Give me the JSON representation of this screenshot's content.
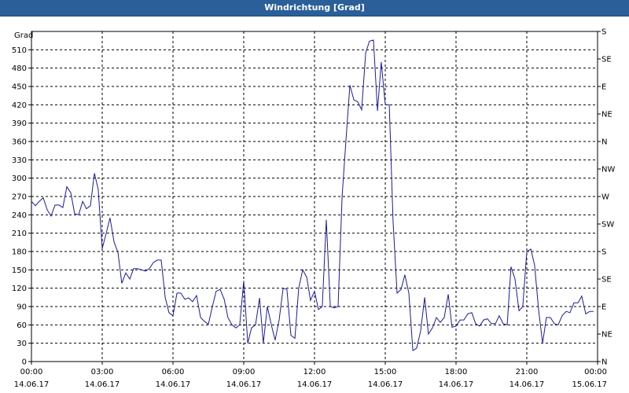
{
  "window": {
    "title": "Windrichtung [Grad]"
  },
  "chart_data": {
    "type": "line",
    "title": "Windrichtung [Grad]",
    "ylabel": "Grad",
    "ylim": [
      0,
      540
    ],
    "yticks": [
      0,
      30,
      60,
      90,
      120,
      150,
      180,
      210,
      240,
      270,
      300,
      330,
      360,
      390,
      420,
      450,
      480,
      510
    ],
    "right_axis_labels": [
      "N",
      "NE",
      "E",
      "SE",
      "S",
      "SW",
      "W",
      "NW",
      "N",
      "NE",
      "E",
      "SE",
      "S"
    ],
    "right_axis_values": [
      0,
      45,
      90,
      135,
      180,
      225,
      270,
      315,
      360,
      405,
      450,
      495,
      540
    ],
    "xlim": [
      0,
      24
    ],
    "xticks": [
      {
        "hours": 0,
        "time": "00:00",
        "date": "14.06.17"
      },
      {
        "hours": 3,
        "time": "03:00",
        "date": "14.06.17"
      },
      {
        "hours": 6,
        "time": "06:00",
        "date": "14.06.17"
      },
      {
        "hours": 9,
        "time": "09:00",
        "date": "14.06.17"
      },
      {
        "hours": 12,
        "time": "12:00",
        "date": "14.06.17"
      },
      {
        "hours": 15,
        "time": "15:00",
        "date": "14.06.17"
      },
      {
        "hours": 18,
        "time": "18:00",
        "date": "14.06.17"
      },
      {
        "hours": 21,
        "time": "21:00",
        "date": "14.06.17"
      },
      {
        "hours": 24,
        "time": "00:00",
        "date": "15.06.17"
      }
    ],
    "grid": true,
    "colors": {
      "series": "#1a1aa0",
      "grid": "#000000",
      "title_bg": "#2a5f9a"
    },
    "series": [
      {
        "x": [
          0.0,
          0.17,
          0.33,
          0.5,
          0.67,
          0.83,
          1.0,
          1.17,
          1.33,
          1.5,
          1.67,
          1.83,
          2.0,
          2.17,
          2.33,
          2.5,
          2.67,
          2.83,
          3.0,
          3.17,
          3.33,
          3.5,
          3.67,
          3.83,
          4.0,
          4.17,
          4.33,
          4.5,
          4.67,
          4.83,
          5.0,
          5.17,
          5.33,
          5.5,
          5.67,
          5.83,
          6.0,
          6.17,
          6.33,
          6.5,
          6.67,
          6.83,
          7.0,
          7.17,
          7.33,
          7.5,
          7.67,
          7.83,
          8.0,
          8.17,
          8.33,
          8.5,
          8.67,
          8.83,
          9.0,
          9.17,
          9.33,
          9.5,
          9.67,
          9.83,
          10.0,
          10.17,
          10.33,
          10.5,
          10.67,
          10.83,
          11.0,
          11.17,
          11.33,
          11.5,
          11.67,
          11.83,
          12.0,
          12.17,
          12.33,
          12.5,
          12.67,
          12.83,
          13.0,
          13.17,
          13.33,
          13.5,
          13.67,
          13.83,
          14.0,
          14.17,
          14.33,
          14.5,
          14.67,
          14.83,
          15.0,
          15.17,
          15.33,
          15.5,
          15.67,
          15.83,
          16.0,
          16.17,
          16.33,
          16.5,
          16.67,
          16.83,
          17.0,
          17.17,
          17.33,
          17.5,
          17.67,
          17.83,
          18.0,
          18.17,
          18.33,
          18.5,
          18.67,
          18.83,
          19.0,
          19.17,
          19.33,
          19.5,
          19.67,
          19.83,
          20.0,
          20.17,
          20.33,
          20.5,
          20.67,
          20.83,
          21.0,
          21.17,
          21.33,
          21.5,
          21.67,
          21.83,
          22.0,
          22.17,
          22.33,
          22.5,
          22.67,
          22.83,
          23.0,
          23.17,
          23.33,
          23.5,
          23.67,
          23.83
        ],
        "y": [
          262,
          255,
          262,
          268,
          248,
          238,
          256,
          256,
          252,
          286,
          276,
          242,
          240,
          262,
          250,
          255,
          308,
          282,
          185,
          210,
          235,
          196,
          178,
          128,
          145,
          135,
          152,
          152,
          150,
          148,
          152,
          162,
          166,
          166,
          105,
          80,
          75,
          112,
          112,
          102,
          104,
          98,
          108,
          72,
          66,
          61,
          90,
          115,
          118,
          102,
          72,
          60,
          55,
          60,
          132,
          30,
          55,
          60,
          104,
          30,
          90,
          60,
          35,
          68,
          120,
          118,
          43,
          38,
          120,
          150,
          138,
          100,
          115,
          85,
          90,
          232,
          90,
          88,
          90,
          270,
          360,
          452,
          428,
          425,
          412,
          505,
          524,
          526,
          410,
          490,
          420,
          420,
          230,
          112,
          118,
          142,
          112,
          18,
          22,
          50,
          105,
          45,
          55,
          72,
          64,
          72,
          110,
          56,
          58,
          68,
          68,
          78,
          80,
          62,
          58,
          68,
          70,
          62,
          62,
          75,
          62,
          60,
          155,
          135,
          83,
          90,
          180,
          184,
          158,
          85,
          30,
          72,
          72,
          62,
          60,
          75,
          82,
          80,
          96,
          96,
          107,
          78,
          82,
          82
        ]
      }
    ]
  }
}
